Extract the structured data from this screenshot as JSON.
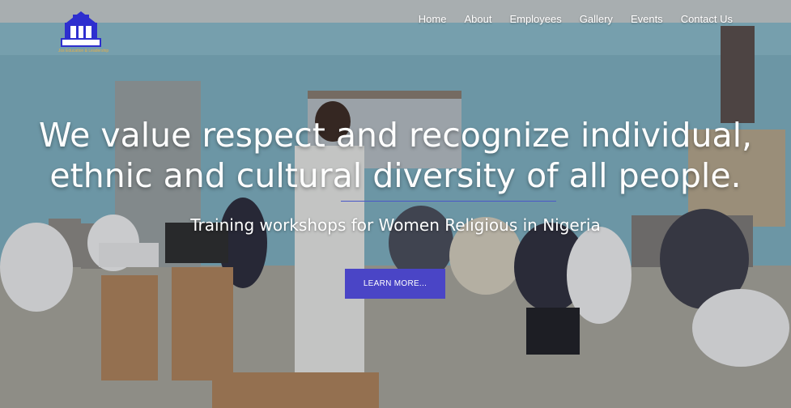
{
  "brand": {
    "logo_text": "Jos Education & Leadership"
  },
  "nav": {
    "items": [
      "Home",
      "About",
      "Employees",
      "Gallery",
      "Events",
      "Contact Us"
    ]
  },
  "hero": {
    "headline_line1": "We value respect and recognize individual,",
    "headline_line2": "ethnic and cultural diversity of all people.",
    "subheadline": "Training workshops for Women Religious in Nigeria",
    "cta_label": "LEARN MORE..."
  },
  "colors": {
    "accent": "#4a45c6",
    "nav_text": "#ffffff",
    "headline_text": "#ffffff",
    "logo_blue": "#2e2fcf",
    "logo_gold": "#e7b04a"
  },
  "icons": {
    "logo": "school-building-logo-icon"
  }
}
